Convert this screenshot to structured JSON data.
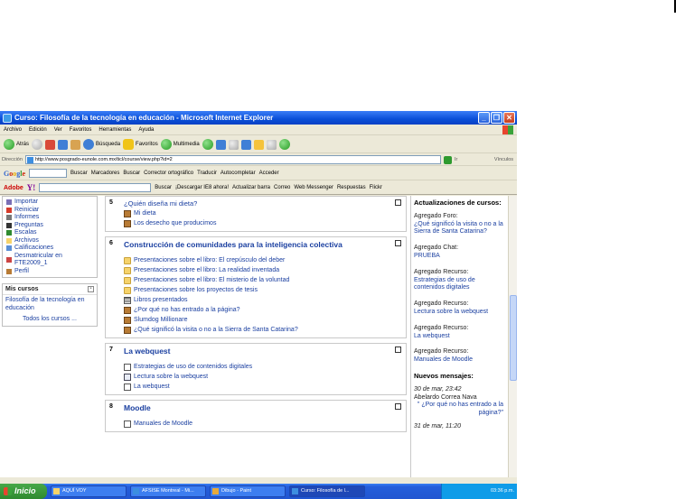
{
  "window": {
    "title": "Curso: Filosofía de la tecnología en educación - Microsoft Internet Explorer",
    "buttons": [
      "_",
      "❐",
      "✕"
    ]
  },
  "menubar": [
    "Archivo",
    "Edición",
    "Ver",
    "Favoritos",
    "Herramientas",
    "Ayuda"
  ],
  "toolbar": {
    "back": "Atrás",
    "search": "Búsqueda",
    "favorites": "Favoritos",
    "multimedia": "Multimedia"
  },
  "address": {
    "label": "Dirección",
    "url": "http://www.posgrado-eunole.com.mx/ticl/course/view.php?id=2",
    "go": "Ir",
    "links": "Vínculos"
  },
  "googlebar": {
    "logo": [
      "G",
      "o",
      "o",
      "g",
      "l",
      "e"
    ],
    "items": [
      "Buscar",
      "Marcadores",
      "Buscar",
      "Corrector ortográfico",
      "Traducir",
      "Autocompletar",
      "Acceder"
    ]
  },
  "adobebar": {
    "adobe": "Adobe",
    "yahoo": "Y!",
    "items": [
      "Buscar",
      "¡Descargar IE8 ahora!",
      "Actualizar barra",
      "Correo",
      "Web Messenger",
      "Respuestas",
      "Flickr"
    ]
  },
  "left_menu": [
    "Importar",
    "Reiniciar",
    "Informes",
    "Preguntas",
    "Escalas",
    "Archivos",
    "Calificaciones",
    "Desmatricular en FTE2009_1",
    "Perfil"
  ],
  "my_courses": {
    "title": "Mis cursos",
    "course": "Filosofía de la tecnología en educación",
    "all": "Todos los cursos ..."
  },
  "sections": [
    {
      "num": "5",
      "title": "¿Quién diseña mi dieta?",
      "plain": true,
      "resources": [
        {
          "icon": "forum",
          "label": "Mi dieta"
        },
        {
          "icon": "forum",
          "label": "Los desecho que producimos"
        }
      ]
    },
    {
      "num": "6",
      "title": "Construcción de comunidades para la inteligencia colectiva",
      "plain": false,
      "resources": [
        {
          "icon": "folder",
          "label": "Presentaciones sobre el libro: El crepúsculo del deber"
        },
        {
          "icon": "folder",
          "label": "Presentaciones sobre el libro: La realidad inventada"
        },
        {
          "icon": "folder",
          "label": "Presentaciones sobre el libro: El misterio de la voluntad"
        },
        {
          "icon": "folder",
          "label": "Presentaciones sobre los proyectos de tesis"
        },
        {
          "icon": "list",
          "label": "Libros presentados"
        },
        {
          "icon": "forum",
          "label": "¿Por qué no has entrado a la página?"
        },
        {
          "icon": "forum",
          "label": "Slumdog Millionare"
        },
        {
          "icon": "forum",
          "label": "¿Qué significó la visita o no a la Sierra de Santa Catarina?"
        }
      ]
    },
    {
      "num": "7",
      "title": "La webquest",
      "plain": false,
      "resources": [
        {
          "icon": "doc",
          "label": "Estrategias de uso de contenidos digitales"
        },
        {
          "icon": "page",
          "label": "Lectura sobre la webquest"
        },
        {
          "icon": "doc",
          "label": "La webquest"
        }
      ]
    },
    {
      "num": "8",
      "title": "Moodle",
      "plain": false,
      "resources": [
        {
          "icon": "doc",
          "label": "Manuales de Moodle"
        }
      ]
    }
  ],
  "updates": {
    "title": "Actualizaciones de cursos:",
    "entries": [
      {
        "label": "Agregado Foro:",
        "link": "¿Qué significó la visita o no a la Sierra de Santa Catarina?"
      },
      {
        "label": "Agregado Chat:",
        "link": "PRUEBA"
      },
      {
        "label": "Agregado Recurso:",
        "link": "Estrategias de uso de contenidos digitales"
      },
      {
        "label": "Agregado Recurso:",
        "link": "Lectura sobre la webquest"
      },
      {
        "label": "Agregado Recurso:",
        "link": "La webquest"
      },
      {
        "label": "Agregado Recurso:",
        "link": "Manuales de Moodle"
      }
    ],
    "news_title": "Nuevos mensajes:",
    "messages": [
      {
        "date": "30 de mar, 23:42",
        "author": "Abelardo Correa Nava",
        "text": "\" ¿Por qué no has entrado a la página?\""
      },
      {
        "date": "31 de mar, 11:20",
        "author": "",
        "text": ""
      }
    ]
  },
  "taskbar": {
    "start": "Inicio",
    "tasks": [
      "AQUÍ VOY",
      "AFSISE Montreal - Mi...",
      "Dibujo - Paint",
      "Curso: Filosofía de l..."
    ],
    "clock": "03:36 p.m."
  }
}
